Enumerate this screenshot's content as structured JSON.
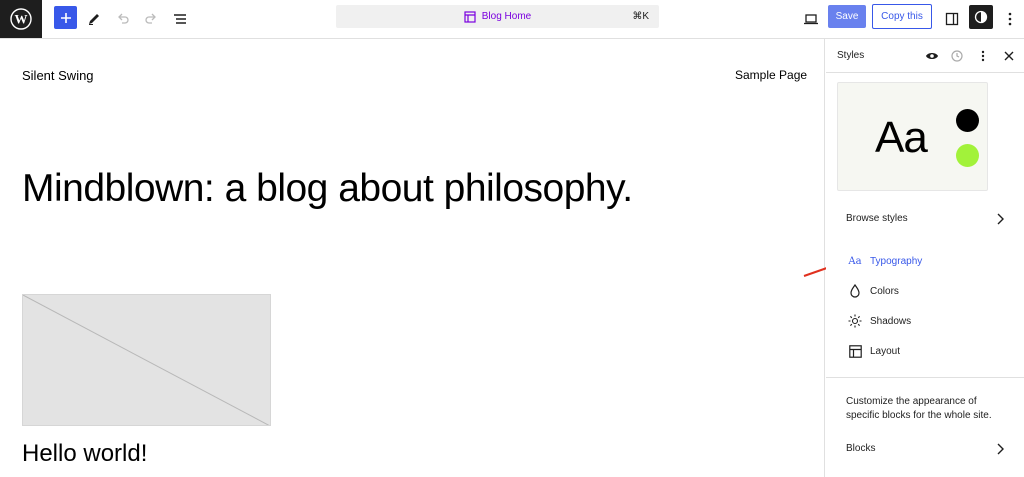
{
  "toolbar": {
    "center_title": "Blog Home",
    "shortcut": "⌘K",
    "save_label": "Save",
    "copy_label": "Copy this",
    "accent_color": "#3858e9"
  },
  "canvas": {
    "site_title": "Silent Swing",
    "nav_link": "Sample Page",
    "headline": "Mindblown: a blog about philosophy.",
    "post_title": "Hello world!"
  },
  "sidebar": {
    "title": "Styles",
    "preview_text": "Aa",
    "preview_colors": [
      "#000000",
      "#a2f23a"
    ],
    "browse_label": "Browse styles",
    "items": [
      {
        "label": "Typography",
        "icon": "typography-icon"
      },
      {
        "label": "Colors",
        "icon": "droplet-icon"
      },
      {
        "label": "Shadows",
        "icon": "sun-icon"
      },
      {
        "label": "Layout",
        "icon": "layout-icon"
      }
    ],
    "description": "Customize the appearance of specific blocks for the whole site.",
    "blocks_label": "Blocks"
  }
}
